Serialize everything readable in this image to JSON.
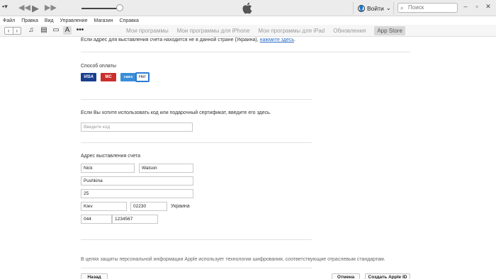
{
  "player": {
    "prev_icon": "rewind-icon",
    "play_icon": "play-icon",
    "next_icon": "fast-forward-icon",
    "volume": 0.9
  },
  "header": {
    "account_label": "Войти",
    "search_placeholder": "Поиск"
  },
  "menubar": {
    "items": [
      "Файл",
      "Правка",
      "Вид",
      "Управление",
      "Магазин",
      "Справка"
    ]
  },
  "tabs": [
    {
      "label": "Мои программы"
    },
    {
      "label": "Мои программы для iPhone"
    },
    {
      "label": "Мои программы для iPad"
    },
    {
      "label": "Обновления"
    },
    {
      "label": "App Store",
      "selected": true
    }
  ],
  "main": {
    "address_note": "Если адрес для выставления счета находится не в данной стране (Украина),",
    "address_link": "нажмите здесь",
    "payment_title": "Способ оплаты",
    "cards": {
      "visa": "VISA",
      "mastercard": "MasterCard",
      "amex": "AMEX",
      "none": "Нет"
    },
    "gift_prompt": "Если Вы хотите использовать код или подарочный сертификат, введите его здесь.",
    "gift_placeholder": "Введите код",
    "billing_title": "Адрес выставления счета",
    "first_name": "Nick",
    "last_name": "Watson",
    "street": "Pushkina",
    "house": "25",
    "city": "Kiev",
    "postcode": "02230",
    "country": "Украина",
    "phone_code": "044",
    "phone_number": "1234567",
    "privacy_note": "В целях защиты персональной информации Apple использует технологии шифрования, соответствующие отраслевым стандартам.",
    "back_button": "Назад",
    "cancel_button": "Отмена",
    "create_button": "Создать Apple ID"
  }
}
